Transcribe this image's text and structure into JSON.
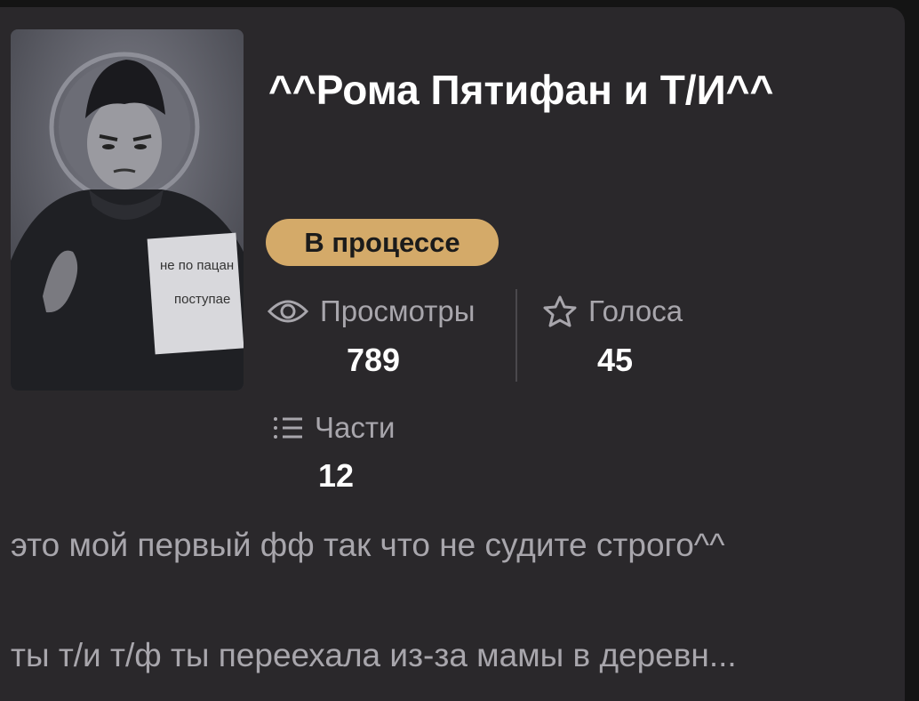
{
  "book": {
    "title": "^^Рома Пятифан и Т/И^^",
    "status": "В процессе",
    "cover_sign_text": [
      "не по пацан",
      "поступае"
    ]
  },
  "stats": {
    "views": {
      "label": "Просмотры",
      "value": "789",
      "icon": "eye-icon"
    },
    "votes": {
      "label": "Голоса",
      "value": "45",
      "icon": "star-icon"
    },
    "parts": {
      "label": "Части",
      "value": "12",
      "icon": "list-icon"
    }
  },
  "description": {
    "line1": "это мой первый фф так что не судите строго^^",
    "line2": "ты т/и т/ф ты переехала из-за мамы в деревн..."
  },
  "colors": {
    "card_bg": "#2a282b",
    "page_bg": "#141414",
    "status_bg": "#d4aa69",
    "muted_text": "#a8a6ac"
  }
}
